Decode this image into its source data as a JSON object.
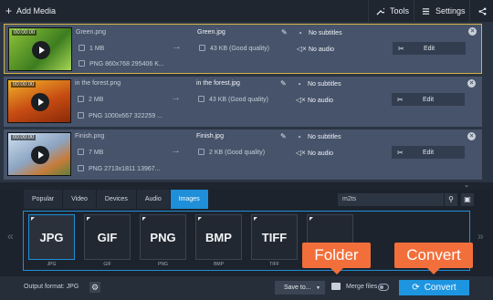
{
  "toolbar": {
    "add_media": "Add Media",
    "tools": "Tools",
    "settings": "Settings"
  },
  "files": [
    {
      "timecode": "00:00:00",
      "name": "Green.png",
      "size": "1 MB",
      "info": "PNG 860x768 295406 K...",
      "out_name": "Green.jpg",
      "out_size": "43 KB (Good quality)",
      "subtitles": "No subtitles",
      "audio": "No audio",
      "edit": "Edit"
    },
    {
      "timecode": "00:00:00",
      "name": "in the forest.png",
      "size": "2 MB",
      "info": "PNG 1000x667 322259 ...",
      "out_name": "in the forest.jpg",
      "out_size": "43 KB (Good quality)",
      "subtitles": "No subtitles",
      "audio": "No audio",
      "edit": "Edit"
    },
    {
      "timecode": "00:00:00",
      "name": "Finish.png",
      "size": "7 MB",
      "info": "PNG 2713x1811 13967...",
      "out_name": "Finish.jpg",
      "out_size": "2 KB (Good quality)",
      "subtitles": "No subtitles",
      "audio": "No audio",
      "edit": "Edit"
    }
  ],
  "tabs": [
    "Popular",
    "Video",
    "Devices",
    "Audio",
    "Images"
  ],
  "active_tab": "Images",
  "search": {
    "value": "m2ts"
  },
  "formats": [
    {
      "label": "JPG",
      "caption": "JPG"
    },
    {
      "label": "GIF",
      "caption": "GIF"
    },
    {
      "label": "PNG",
      "caption": "PNG"
    },
    {
      "label": "BMP",
      "caption": "BMP"
    },
    {
      "label": "TIFF",
      "caption": "TIFF"
    },
    {
      "label": "",
      "caption": ""
    }
  ],
  "bottom": {
    "output_format": "Output format: JPG",
    "save_to": "Save to...",
    "merge_files": "Merge files",
    "convert": "Convert"
  },
  "callouts": {
    "folder": "Folder",
    "convert": "Convert"
  },
  "colors": {
    "accent": "#1e95e0",
    "callout": "#f26f3b",
    "selected_border": "#d6b341"
  }
}
